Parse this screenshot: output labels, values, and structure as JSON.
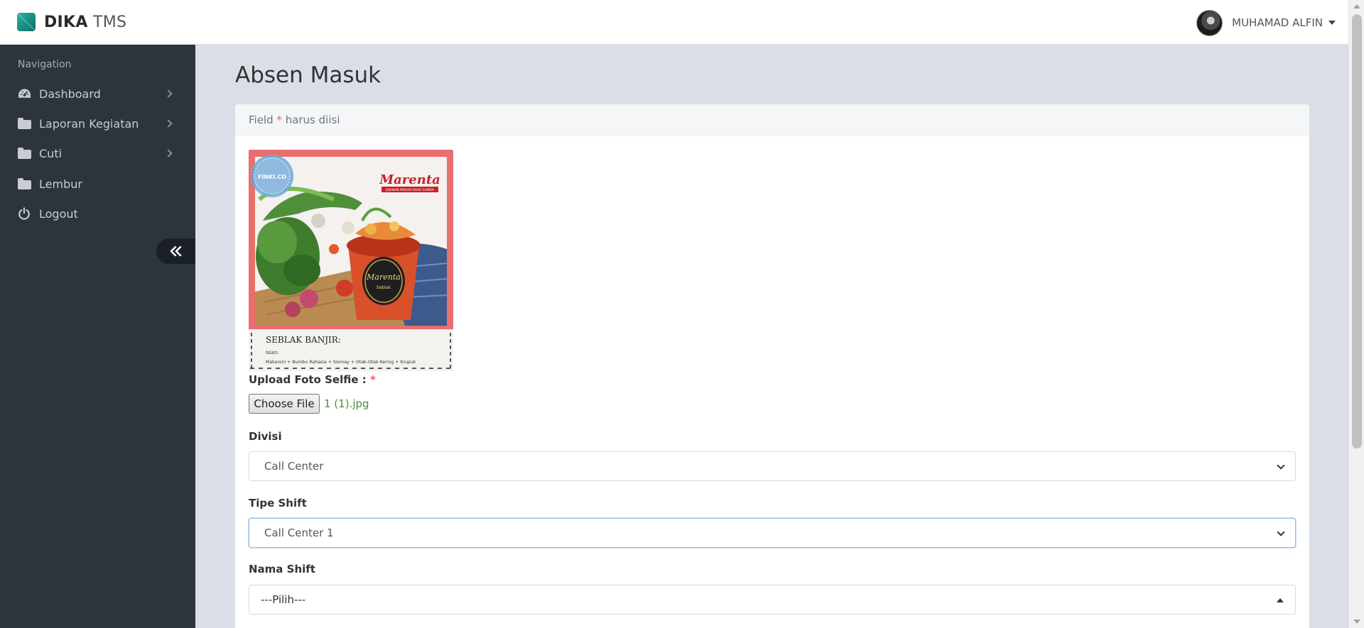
{
  "app": {
    "brand_strong": "DIKA",
    "brand_light": "TMS",
    "accent_color": "#1a8f83"
  },
  "user": {
    "name": "MUHAMAD ALFIN"
  },
  "sidebar": {
    "heading": "Navigation",
    "items": [
      {
        "label": "Dashboard",
        "icon": "dashboard-gauge-icon",
        "has_submenu": true
      },
      {
        "label": "Laporan Kegiatan",
        "icon": "folder-icon",
        "has_submenu": true
      },
      {
        "label": "Cuti",
        "icon": "folder-icon",
        "has_submenu": true
      },
      {
        "label": "Lembur",
        "icon": "folder-icon",
        "has_submenu": false
      },
      {
        "label": "Logout",
        "icon": "power-icon",
        "has_submenu": false
      }
    ],
    "collapse_icon": "double-chevron-left-icon"
  },
  "page": {
    "title": "Absen Masuk",
    "required_note_prefix": "Field",
    "required_mark": "*",
    "required_note_suffix": "harus diisi"
  },
  "photo_preview": {
    "brand_script": "Marenta",
    "brand_tagline": "JAJANAN MURAH KHAS SUNDA",
    "badge_text": "FINKI.CO",
    "cup_label": "Marenta",
    "cup_sublabel": "Seblak",
    "title": "SEBLAK BANJIR:",
    "isian_label": "Isian:",
    "isian_text": "Makaroni + Bumbu Rahasia + Siomay + Otak-Otak Kering + Krupuk"
  },
  "form": {
    "upload_label": "Upload Foto Selfie :",
    "required_mark": "*",
    "choose_file_label": "Choose File",
    "file_name": "1 (1).jpg",
    "divisi_label": "Divisi",
    "divisi_value": "Call Center",
    "tipe_shift_label": "Tipe Shift",
    "tipe_shift_value": "Call Center 1",
    "nama_shift_label": "Nama Shift",
    "nama_shift_value": "---Pilih---"
  }
}
